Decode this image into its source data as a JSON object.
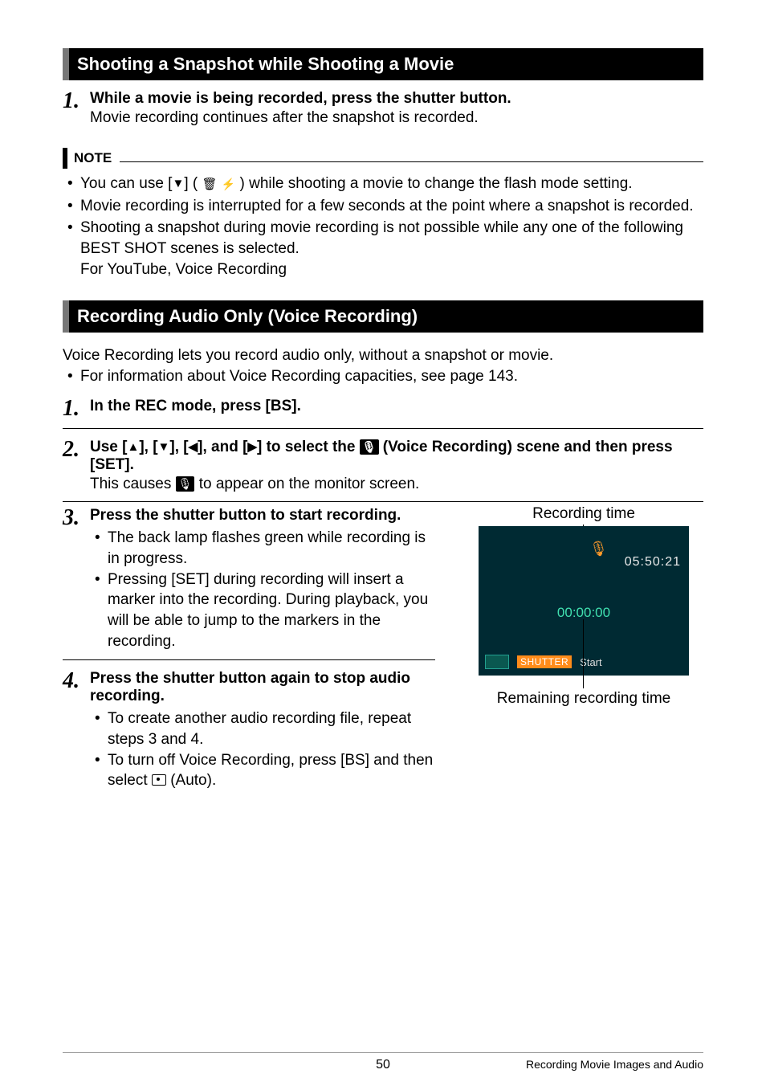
{
  "section1": {
    "title": "Shooting a Snapshot while Shooting a Movie",
    "step1_title": "While a movie is being recorded, press the shutter button.",
    "step1_text": "Movie recording continues after the snapshot is recorded."
  },
  "note": {
    "label": "NOTE",
    "items": {
      "a_pre": "You can use [",
      "a_post": "] ( ",
      "a_post2": " ) while shooting a movie to change the flash mode setting.",
      "b": "Movie recording is interrupted for a few seconds at the point where a snapshot is recorded.",
      "c1": "Shooting a snapshot during movie recording is not possible while any one of the following BEST SHOT scenes is selected.",
      "c2": "For YouTube, Voice Recording"
    }
  },
  "section2": {
    "title": "Recording Audio Only (Voice Recording)",
    "intro1": "Voice Recording lets you record audio only, without a snapshot or movie.",
    "intro2": "For information about Voice Recording capacities, see page 143.",
    "step1_title": "In the REC mode, press [BS].",
    "step2_pre": "Use [",
    "step2_mid1": "], [",
    "step2_mid2": "], [",
    "step2_mid3": "], and [",
    "step2_post": "] to select the ",
    "step2_post2": " (Voice Recording) scene and then press [SET].",
    "step2_text_pre": "This causes ",
    "step2_text_post": " to appear on the monitor screen.",
    "step3_title": "Press the shutter button to start recording.",
    "step3_b1": "The back lamp flashes green while recording is in progress.",
    "step3_b2": "Pressing [SET] during recording will insert a marker into the recording. During playback, you will be able to jump to the markers in the recording.",
    "step4_title": "Press the shutter button again to stop audio recording.",
    "step4_b1": "To create another audio recording file, repeat steps 3 and 4.",
    "step4_b2_pre": "To turn off Voice Recording, press [BS] and then select ",
    "step4_b2_post": " (Auto)."
  },
  "screen": {
    "rec_label": "Recording time",
    "rec_time": "05:50:21",
    "counter": "00:00:00",
    "shutter": "SHUTTER",
    "start": "Start",
    "remaining": "Remaining recording time"
  },
  "footer": {
    "page": "50",
    "section": "Recording Movie Images and Audio"
  },
  "glyphs": {
    "down": "▼",
    "up": "▲",
    "left": "◀",
    "right": "▶",
    "mic_chip": "🎤",
    "trash": "🗑",
    "flash": "⚡"
  }
}
